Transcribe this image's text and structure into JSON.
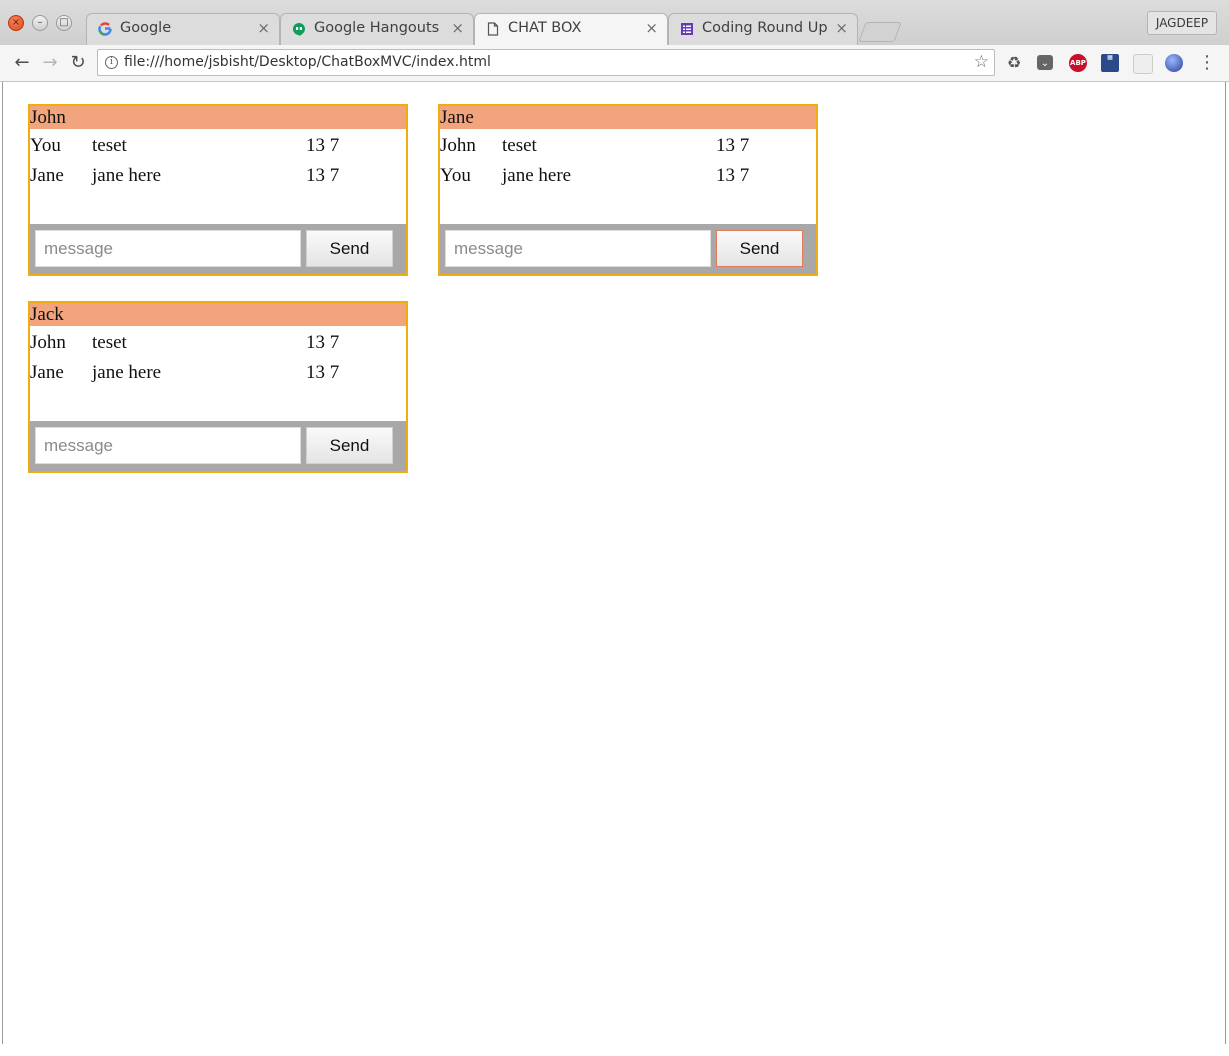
{
  "window": {
    "profile_name": "JAGDEEP"
  },
  "tabs": [
    {
      "label": "Google",
      "icon": "google-g-icon"
    },
    {
      "label": "Google Hangouts",
      "icon": "hangouts-icon"
    },
    {
      "label": "CHAT BOX",
      "icon": "page-icon",
      "active": true
    },
    {
      "label": "Coding Round Uplo",
      "icon": "forms-icon"
    }
  ],
  "toolbar": {
    "url": "file:///home/jsbisht/Desktop/ChatBoxMVC/index.html"
  },
  "chat_boxes": [
    {
      "title": "John",
      "messages": [
        {
          "sender": "You",
          "text": "teset",
          "time": "13 7"
        },
        {
          "sender": "Jane",
          "text": "jane here",
          "time": "13 7"
        }
      ],
      "input_placeholder": "message",
      "send_label": "Send"
    },
    {
      "title": "Jane",
      "messages": [
        {
          "sender": "John",
          "text": "teset",
          "time": "13 7"
        },
        {
          "sender": "You",
          "text": "jane here",
          "time": "13 7"
        }
      ],
      "input_placeholder": "message",
      "send_label": "Send"
    },
    {
      "title": "Jack",
      "messages": [
        {
          "sender": "John",
          "text": "teset",
          "time": "13 7"
        },
        {
          "sender": "Jane",
          "text": "jane here",
          "time": "13 7"
        }
      ],
      "input_placeholder": "message",
      "send_label": "Send"
    }
  ],
  "colors": {
    "box_border": "#f0ad0f",
    "box_header": "#f2a47c",
    "box_footer": "#a8a8a8"
  }
}
